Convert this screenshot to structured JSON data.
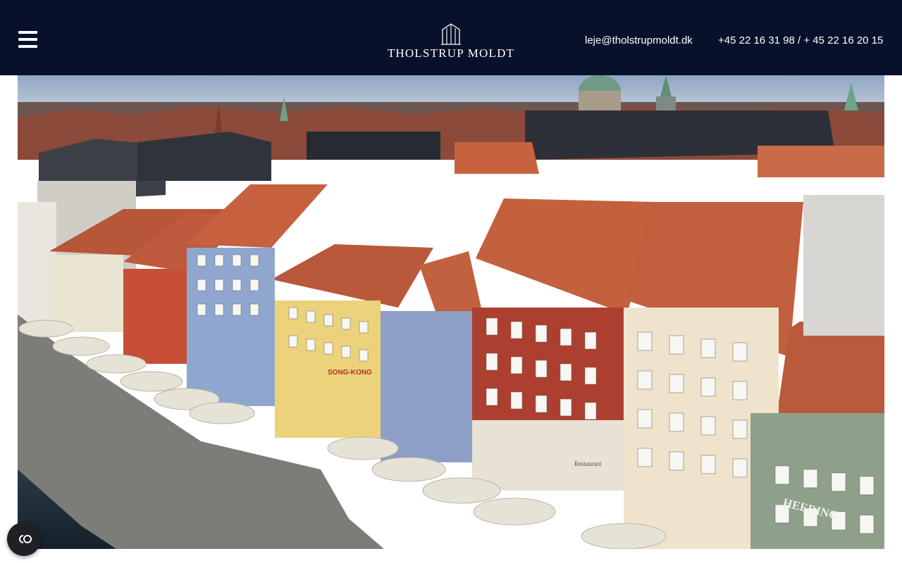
{
  "header": {
    "brand_name": "THOLSTRUP MOLDT",
    "email": "leje@tholstrupmoldt.dk",
    "phone": "+45 22 16 31 98 / + 45 22 16 20 15",
    "background_color": "#08112b"
  },
  "icons": {
    "menu": "hamburger-menu-icon",
    "logo": "building-logo-icon",
    "cookie": "cookie-consent-icon"
  },
  "hero": {
    "signs": {
      "restaurant_one": "Restaurant",
      "sign_song": "SONG-KONG",
      "sign_heering": "HEERING"
    }
  }
}
